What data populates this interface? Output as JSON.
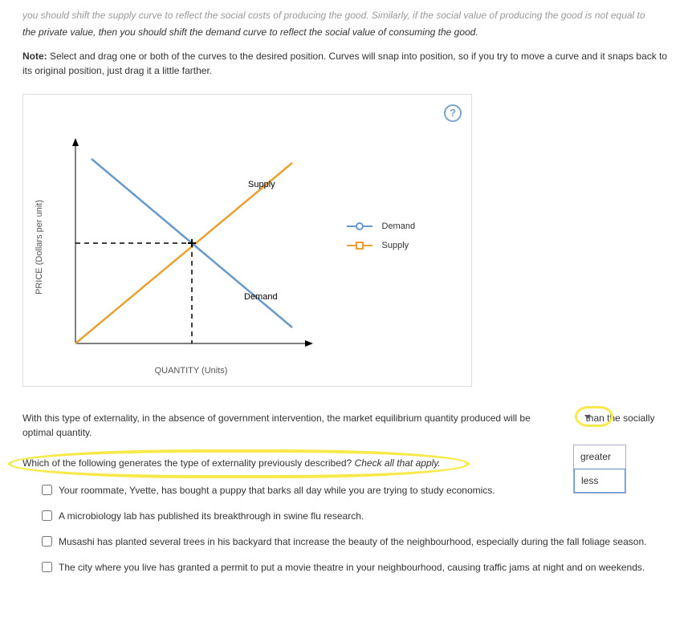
{
  "intro": {
    "cutoff": "you should shift the supply curve to reflect the social costs of producing the good. Similarly, if the social value of producing the good is not equal to",
    "line2": "the private value, then you should shift the demand curve to reflect the social value of consuming the good.",
    "note_label": "Note:",
    "note_text": " Select and drag one or both of the curves to the desired position. Curves will snap into position, so if you try to move a curve and it snaps back to its original position, just drag it a little farther."
  },
  "graph": {
    "y_label": "PRICE (Dollars per unit)",
    "x_label": "QUANTITY (Units)",
    "supply_label": "Supply",
    "demand_label": "Demand",
    "help": "?"
  },
  "legend": {
    "demand": "Demand",
    "supply": "Supply"
  },
  "q1": {
    "before": "With this type of externality, in the absence of government intervention, the market equilibrium quantity produced will be ",
    "after": " than the socially optimal quantity.",
    "opt1": "greater",
    "opt2": "less"
  },
  "q2": {
    "prompt": "Which of the following generates the type of externality previously described? ",
    "hint": "Check all that apply.",
    "choices": [
      "Your roommate, Yvette, has bought a puppy that barks all day while you are trying to study economics.",
      "A microbiology lab has published its breakthrough in swine flu research.",
      "Musashi has planted several trees in his backyard that increase the beauty of the neighbourhood, especially during the fall foliage season.",
      "The city where you live has granted a permit to put a movie theatre in your neighbourhood, causing traffic jams at night and on weekends."
    ]
  },
  "chart_data": {
    "type": "line",
    "series": [
      {
        "name": "Supply",
        "points": [
          [
            0,
            0
          ],
          [
            100,
            100
          ]
        ],
        "color": "#e8a132"
      },
      {
        "name": "Demand",
        "points": [
          [
            0,
            100
          ],
          [
            100,
            0
          ]
        ],
        "color": "#6699cc"
      }
    ],
    "equilibrium": {
      "x": 50,
      "y": 50
    },
    "guides": {
      "dashed_x": 50,
      "dashed_y": 50
    },
    "xlabel": "QUANTITY (Units)",
    "ylabel": "PRICE (Dollars per unit)",
    "xlim": [
      0,
      100
    ],
    "ylim": [
      0,
      100
    ]
  }
}
